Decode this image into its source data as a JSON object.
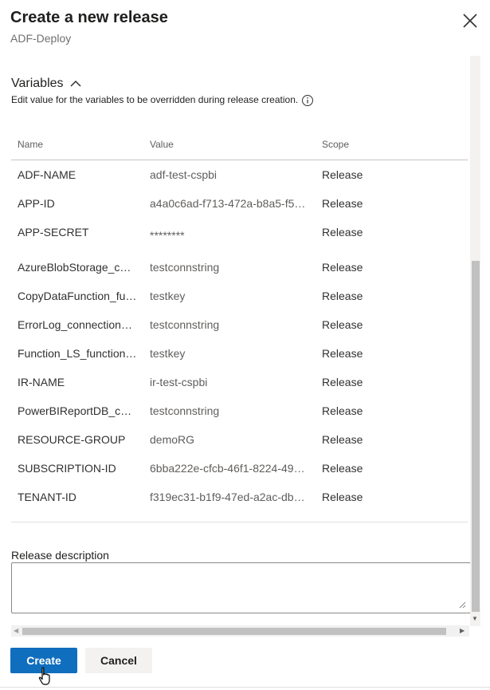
{
  "dialog": {
    "title": "Create a new release",
    "subtitle": "ADF-Deploy",
    "close_icon": "close-icon"
  },
  "variables": {
    "section_title": "Variables",
    "description": "Edit value for the variables to be overridden during release creation.",
    "columns": {
      "name": "Name",
      "value": "Value",
      "scope": "Scope"
    },
    "rows": [
      {
        "name": "ADF-NAME",
        "value": "adf-test-cspbi",
        "scope": "Release"
      },
      {
        "name": "APP-ID",
        "value": "a4a0c6ad-f713-472a-b8a5-f50…",
        "scope": "Release"
      },
      {
        "name": "APP-SECRET",
        "value": "********",
        "scope": "Release"
      },
      {
        "name": "AzureBlobStorage_co…",
        "value": "testconnstring",
        "scope": "Release"
      },
      {
        "name": "CopyDataFunction_fu…",
        "value": "testkey",
        "scope": "Release"
      },
      {
        "name": "ErrorLog_connectionS…",
        "value": "testconnstring",
        "scope": "Release"
      },
      {
        "name": "Function_LS_function…",
        "value": "testkey",
        "scope": "Release"
      },
      {
        "name": "IR-NAME",
        "value": "ir-test-cspbi",
        "scope": "Release"
      },
      {
        "name": "PowerBIReportDB_co…",
        "value": "testconnstring",
        "scope": "Release"
      },
      {
        "name": "RESOURCE-GROUP",
        "value": "demoRG",
        "scope": "Release"
      },
      {
        "name": "SUBSCRIPTION-ID",
        "value": "6bba222e-cfcb-46f1-8224-49c…",
        "scope": "Release"
      },
      {
        "name": "TENANT-ID",
        "value": "f319ec31-b1f9-47ed-a2ac-dbc…",
        "scope": "Release"
      }
    ]
  },
  "release_description": {
    "label": "Release description",
    "value": ""
  },
  "buttons": {
    "create": "Create",
    "cancel": "Cancel"
  },
  "colors": {
    "primary": "#106ebe",
    "secondary_bg": "#f3f2f1"
  }
}
